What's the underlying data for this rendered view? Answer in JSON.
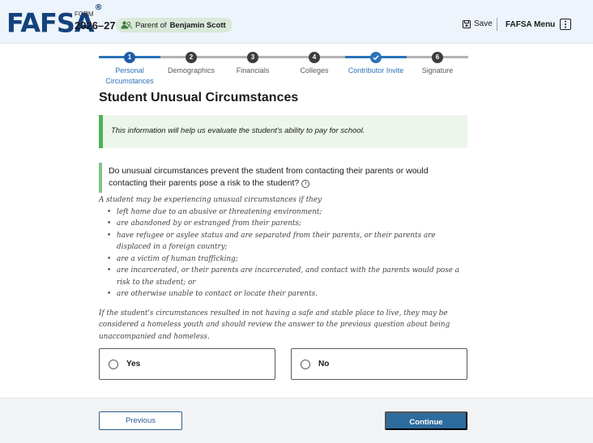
{
  "header": {
    "logo": "FAFSA",
    "logo_mark": "®",
    "form_label": "FORM",
    "form_year": "2026–27",
    "parent_prefix": "Parent of",
    "parent_name": "Benjamin Scott",
    "save_label": "Save",
    "menu_label": "FAFSA Menu"
  },
  "stepper": {
    "steps": [
      {
        "number": "1",
        "line1": "Personal",
        "line2": "Circumstances",
        "state": "active"
      },
      {
        "number": "2",
        "line1": "Demographics",
        "line2": "",
        "state": "upcoming"
      },
      {
        "number": "3",
        "line1": "Financials",
        "line2": "",
        "state": "upcoming"
      },
      {
        "number": "4",
        "line1": "Colleges",
        "line2": "",
        "state": "upcoming"
      },
      {
        "number": "",
        "line1": "Contributor Invite",
        "line2": "",
        "state": "complete"
      },
      {
        "number": "6",
        "line1": "Signature",
        "line2": "",
        "state": "upcoming"
      }
    ]
  },
  "page": {
    "title": "Student Unusual Circumstances",
    "info": "This information will help us evaluate the student's ability to pay for school.",
    "question": "Do unusual circumstances prevent the student from contacting their parents or would contacting their parents pose a risk to the student?",
    "intro": "A student may be experiencing unusual circumstances if they",
    "bullets": [
      "left home due to an abusive or threatening environment;",
      "are abandoned by or estranged from their parents;",
      "have refugee or asylee status and are separated from their parents, or their parents are displaced in a foreign country;",
      "are a victim of human trafficking;",
      "are incarcerated, or their parents are incarcerated, and contact with the parents would pose a risk to the student; or",
      "are otherwise unable to contact or locate their parents."
    ],
    "closing": "If the student's circumstances resulted in not having a safe and stable place to live, they may be considered a homeless youth and should review the answer to the previous question about being unaccompanied and homeless."
  },
  "options": {
    "yes_label": "Yes",
    "no_label": "No"
  },
  "footer": {
    "previous_label": "Previous",
    "continue_label": "Continue"
  },
  "colors": {
    "brand": "#13427c",
    "accent_blue": "#2b73b8",
    "success_green": "#4db257",
    "continue_button": "#2d6c9e"
  }
}
